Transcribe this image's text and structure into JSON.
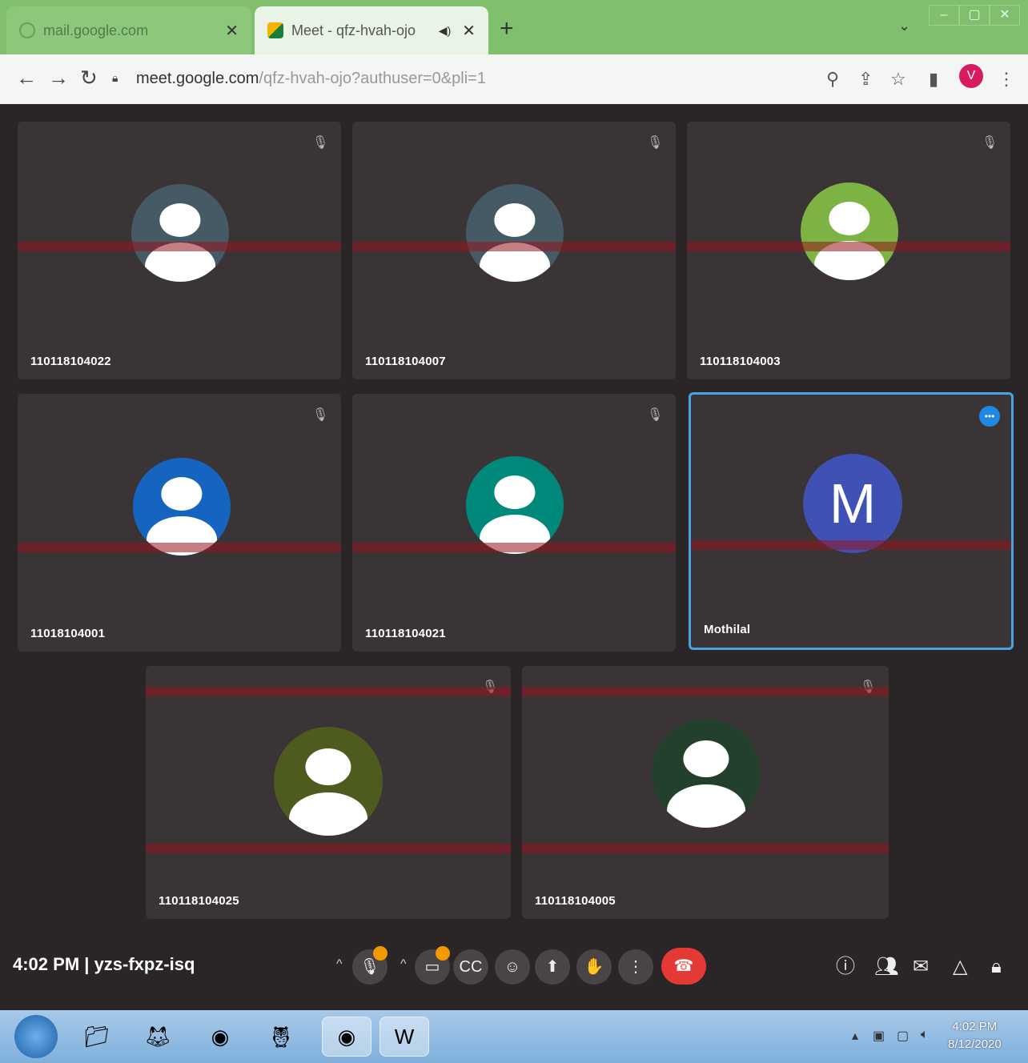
{
  "browser": {
    "tabs": [
      {
        "title": "mail.google.com",
        "active": false
      },
      {
        "title": "Meet - qfz-hvah-ojo",
        "active": true
      }
    ],
    "new_tab_symbol": "+",
    "tab_menu_symbol": "⌄",
    "window_controls": [
      "–",
      "▢",
      "✕"
    ],
    "url_host": "meet.google.com",
    "url_path": "/qfz-hvah-ojo?authuser=0&pli=1",
    "profile_initial": "V"
  },
  "meet": {
    "participants": [
      {
        "name": "110118104022",
        "avatar_color": "#455a64"
      },
      {
        "name": "110118104007",
        "avatar_color": "#455a64"
      },
      {
        "name": "110118104003",
        "avatar_color": "#7cb342"
      },
      {
        "name": "11018104001",
        "avatar_color": "#1565c0"
      },
      {
        "name": "110118104021",
        "avatar_color": "#00897b"
      },
      {
        "name": "Mothilal",
        "avatar_letter": "M",
        "avatar_color": "#3f51b5",
        "selected": true
      },
      {
        "name": "110118104025",
        "avatar_color": "#4e5b1f"
      },
      {
        "name": "110118104005",
        "avatar_color": "#23402c"
      }
    ],
    "time": "4:02 PM",
    "separator": "|",
    "meeting_code": "yzs-fxpz-isq"
  },
  "taskbar": {
    "clock_time": "4:02 PM",
    "clock_date": "8/12/2020"
  },
  "colors": {
    "tabstrip": "#7fbf6e",
    "stage": "#2a2527",
    "tile": "#3a3436",
    "end_call": "#e53935",
    "selected_border": "#4aa3e0"
  }
}
